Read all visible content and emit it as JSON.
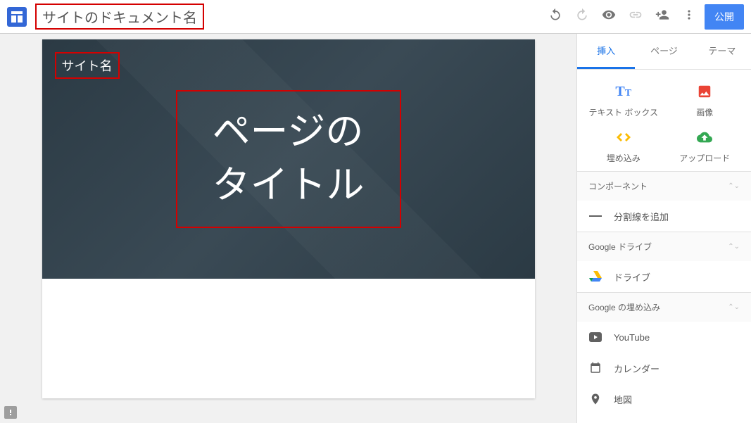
{
  "topbar": {
    "doc_name": "サイトのドキュメント名",
    "publish": "公開"
  },
  "canvas": {
    "site_name": "サイト名",
    "page_title_line1": "ページの",
    "page_title_line2": "タイトル"
  },
  "sidebar": {
    "tabs": {
      "insert": "挿入",
      "pages": "ページ",
      "themes": "テーマ"
    },
    "quick": {
      "textbox": "テキスト ボックス",
      "image": "画像",
      "embed": "埋め込み",
      "upload": "アップロード"
    },
    "section_components": "コンポーネント",
    "divider": "分割線を追加",
    "section_drive": "Google ドライブ",
    "drive": "ドライブ",
    "section_gembed": "Google の埋め込み",
    "youtube": "YouTube",
    "calendar": "カレンダー",
    "map": "地図"
  }
}
